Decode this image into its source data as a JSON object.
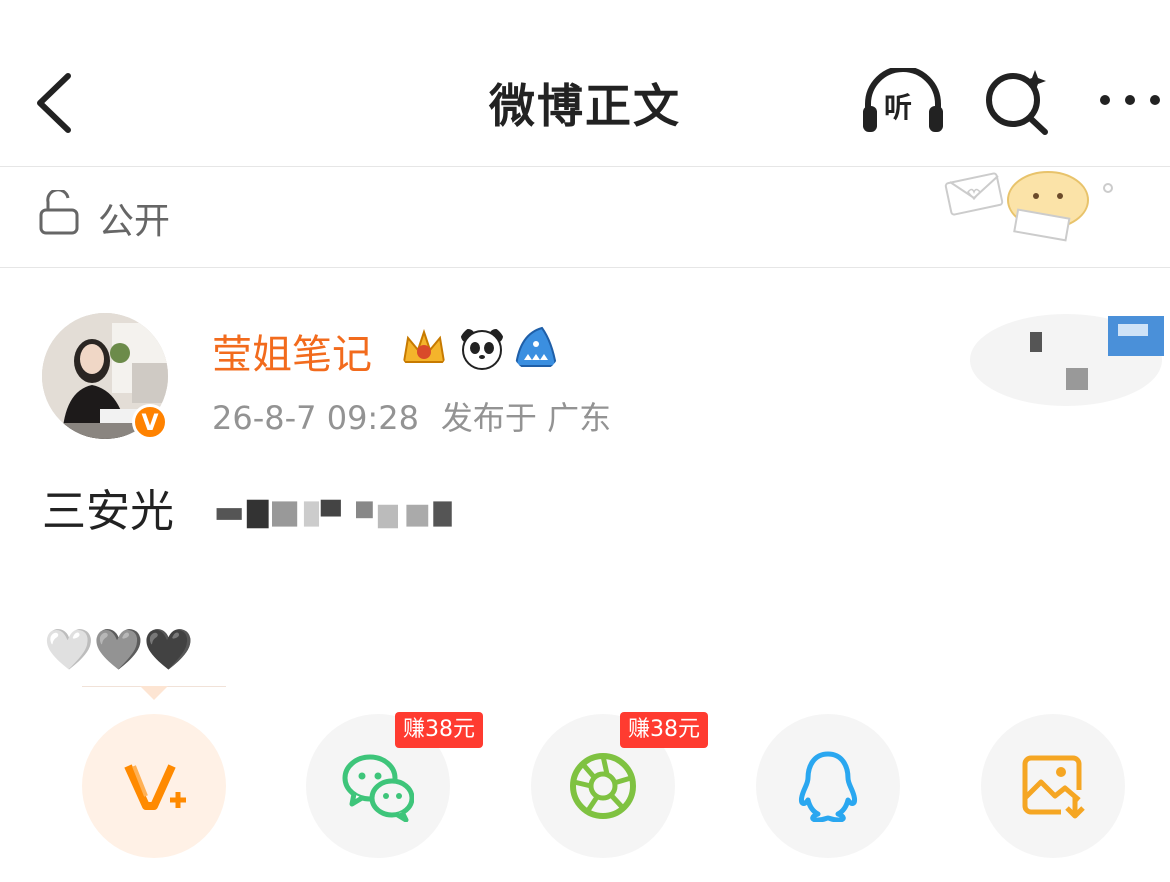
{
  "header": {
    "title": "微博正文",
    "listen_label": "听",
    "back_icon": "chevron-left-icon",
    "search_icon": "search-sparkle-icon",
    "more_icon": "more-dots-icon"
  },
  "visibility": {
    "icon": "unlock-icon",
    "label": "公开"
  },
  "post": {
    "author": "莹姐笔记",
    "verified_mark": "V",
    "timestamp": "26-8-7 09:28",
    "location": "发布于 广东",
    "text": "三安光",
    "hearts": "🤍🩶🖤"
  },
  "share": {
    "items": [
      {
        "name": "weibo-share",
        "icon": "weibo-v-plus-icon"
      },
      {
        "name": "wechat-share",
        "icon": "wechat-icon",
        "reward": "赚38元"
      },
      {
        "name": "moments-share",
        "icon": "moments-icon",
        "reward": "赚38元"
      },
      {
        "name": "qq-share",
        "icon": "qq-icon"
      },
      {
        "name": "save-image",
        "icon": "save-image-icon"
      }
    ]
  },
  "colors": {
    "accent_orange": "#f26b1d",
    "wechat_green": "#3ec57a",
    "moments_green": "#7fc241",
    "qq_blue": "#2aa7f0",
    "reward_red": "#ff3b30"
  }
}
